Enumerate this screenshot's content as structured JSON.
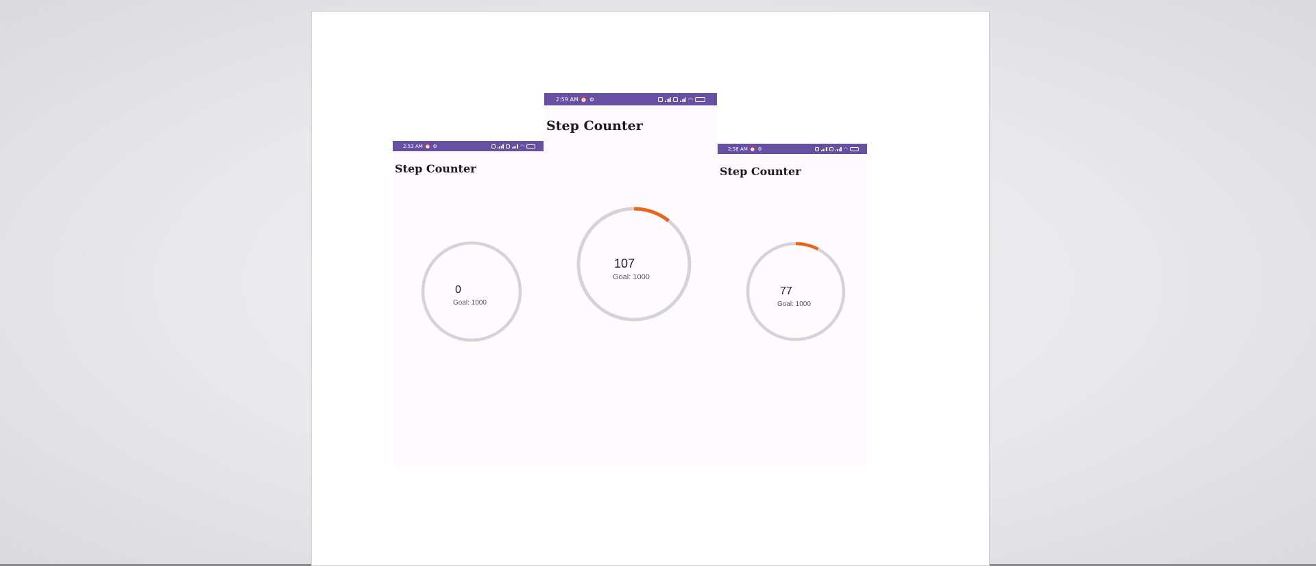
{
  "colors": {
    "status_bar": "#6750a4",
    "ring_track": "#d4d4d4",
    "ring_progress": "#e8651a",
    "screen_bg": "#fffafd"
  },
  "screens": [
    {
      "status_time": "2:53 AM",
      "title": "Step Counter",
      "steps": "0",
      "steps_value": 0,
      "goal_text": "Goal: 1000",
      "goal_value": 1000
    },
    {
      "status_time": "2:59 AM",
      "title": "Step Counter",
      "steps": "107",
      "steps_value": 107,
      "goal_text": "Goal: 1000",
      "goal_value": 1000
    },
    {
      "status_time": "2:58 AM",
      "title": "Step Counter",
      "steps": "77",
      "steps_value": 77,
      "goal_text": "Goal: 1000",
      "goal_value": 1000
    }
  ],
  "icons": {
    "status_left": [
      "alarm-icon",
      "settings-icon"
    ],
    "status_right": [
      "sim-icon",
      "signal-icon",
      "sim-icon",
      "signal-icon",
      "wifi-icon",
      "battery-icon"
    ]
  }
}
